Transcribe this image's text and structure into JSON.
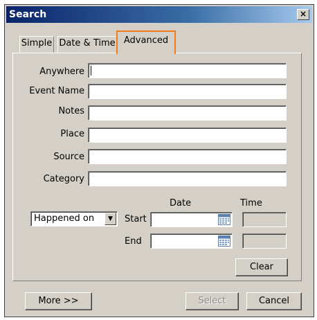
{
  "window": {
    "title": "Search",
    "close_label": "×"
  },
  "tabs": [
    {
      "label": "Simple",
      "active": false
    },
    {
      "label": "Date & Time",
      "active": false
    },
    {
      "label": "Advanced",
      "active": true
    }
  ],
  "fields": [
    {
      "label": "Anywhere",
      "value": ""
    },
    {
      "label": "Event Name",
      "value": ""
    },
    {
      "label": "Notes",
      "value": ""
    },
    {
      "label": "Place",
      "value": ""
    },
    {
      "label": "Source",
      "value": ""
    },
    {
      "label": "Category",
      "value": ""
    }
  ],
  "date_filter": {
    "mode_selected": "Happened on",
    "date_header": "Date",
    "time_header": "Time",
    "start_label": "Start",
    "end_label": "End",
    "start_date": "",
    "end_date": "",
    "start_time": "",
    "end_time": ""
  },
  "buttons": {
    "clear": "Clear",
    "more": "More >>",
    "select": "Select",
    "cancel": "Cancel"
  },
  "icons": {
    "calendar": "calendar-icon",
    "dropdown": "chevron-down-icon",
    "close": "close-icon"
  }
}
